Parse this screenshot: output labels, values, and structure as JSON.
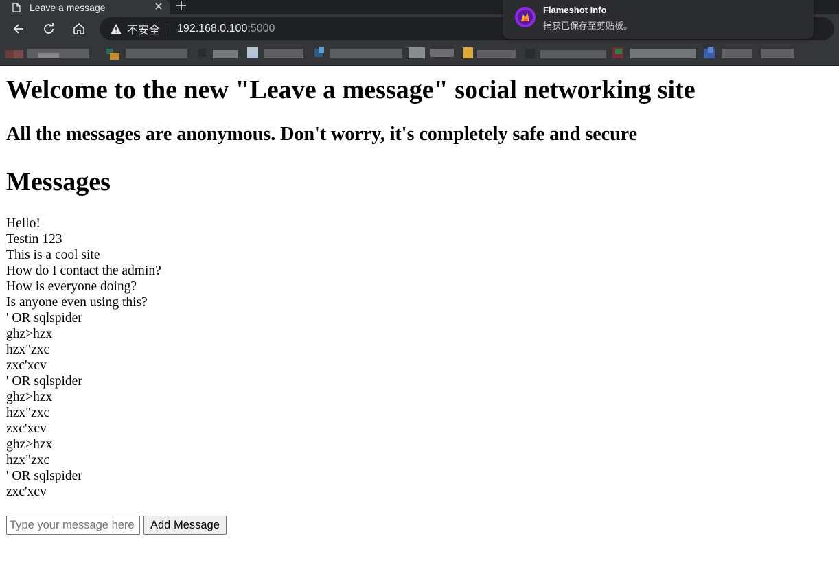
{
  "browser": {
    "tab_title": "Leave a message",
    "security_label": "不安全",
    "url_host": "192.168.0.100",
    "url_port": ":5000",
    "colors": {
      "chrome_bg": "#35363a",
      "tabstrip_bg": "#202124",
      "text": "#e8eaed"
    }
  },
  "notification": {
    "title": "Flameshot Info",
    "body": "捕获已保存至剪贴板。",
    "icon": "flameshot-icon"
  },
  "page": {
    "heading": "Welcome to the new \"Leave a message\" social networking site",
    "subheading": "All the messages are anonymous. Don't worry, it's completely safe and secure",
    "messages_heading": "Messages",
    "messages": [
      "Hello!",
      "Testin 123",
      "This is a cool site",
      "How do I contact the admin?",
      "How is everyone doing?",
      "Is anyone even using this?",
      "' OR sqlspider",
      "ghz>hzx",
      "hzx\"zxc",
      "zxc'xcv",
      "' OR sqlspider",
      "ghz>hzx",
      "hzx\"zxc",
      "zxc'xcv",
      "ghz>hzx",
      "hzx\"zxc",
      "' OR sqlspider",
      "zxc'xcv"
    ],
    "input_placeholder": "Type your message here",
    "input_value": "",
    "button_label": "Add Message"
  }
}
